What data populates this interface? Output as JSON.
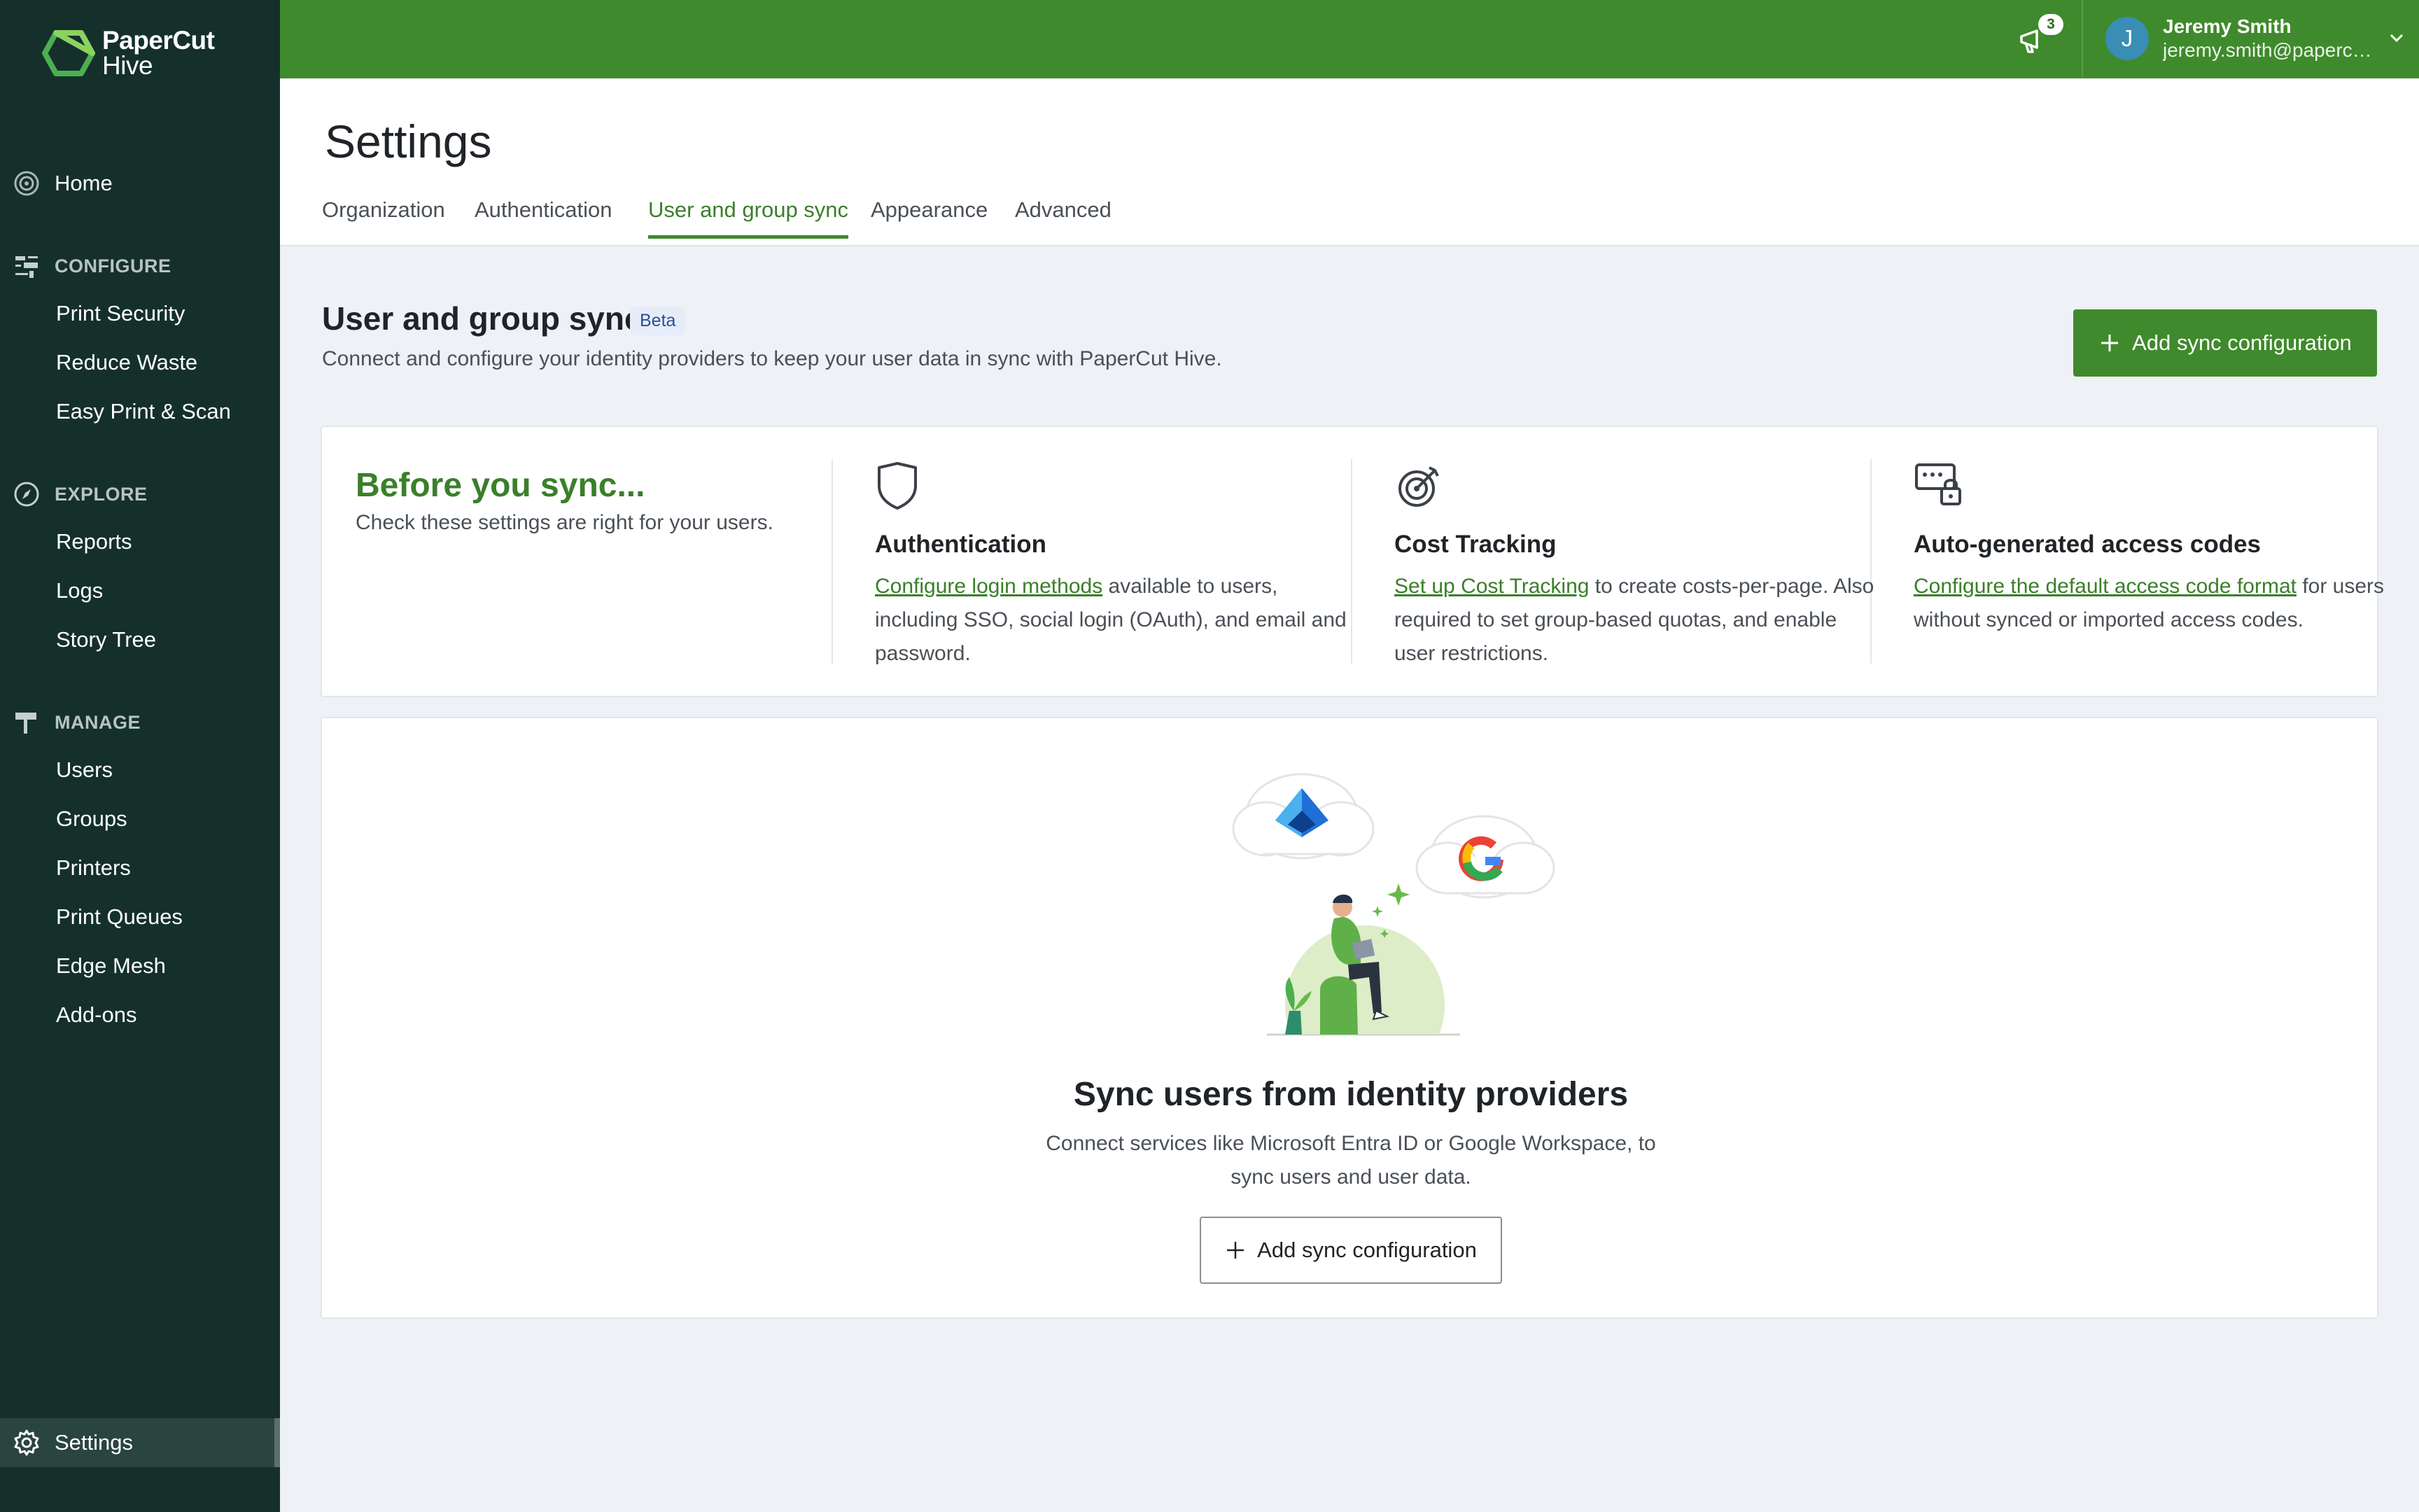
{
  "brand": {
    "line1": "PaperCut",
    "line2": "Hive",
    "color": "#3f8a2c"
  },
  "sidebar": {
    "home": "Home",
    "sections": [
      {
        "label": "CONFIGURE",
        "icon": "sliders-icon",
        "items": [
          "Print Security",
          "Reduce Waste",
          "Easy Print & Scan"
        ]
      },
      {
        "label": "EXPLORE",
        "icon": "compass-icon",
        "items": [
          "Reports",
          "Logs",
          "Story Tree"
        ]
      },
      {
        "label": "MANAGE",
        "icon": "signpost-icon",
        "items": [
          "Users",
          "Groups",
          "Printers",
          "Print Queues",
          "Edge Mesh",
          "Add-ons"
        ]
      }
    ],
    "settings": "Settings"
  },
  "topbar": {
    "notification_count": "3",
    "user": {
      "initial": "J",
      "name": "Jeremy Smith",
      "email": "jeremy.smith@papercut.com"
    }
  },
  "header": {
    "title": "Settings",
    "tabs": [
      "Organization",
      "Authentication",
      "User and group sync",
      "Appearance",
      "Advanced"
    ],
    "active_tab": "User and group sync"
  },
  "section": {
    "title": "User and group sync",
    "badge": "Beta",
    "subtitle": "Connect and configure your identity providers to keep your user data in sync with PaperCut Hive.",
    "add_button": "Add sync configuration"
  },
  "before_sync": {
    "title": "Before you sync...",
    "subtitle": "Check these settings are right for your users.",
    "columns": [
      {
        "icon": "shield-icon",
        "title": "Authentication",
        "link": "Configure login methods",
        "text": " available to users, including SSO, social login (OAuth), and email and password."
      },
      {
        "icon": "target-icon",
        "title": "Cost Tracking",
        "link": "Set up Cost Tracking",
        "text": " to create costs-per-page. Also required to set group-based quotas, and enable user restrictions."
      },
      {
        "icon": "access-code-lock-icon",
        "title": "Auto-generated access codes",
        "link": "Configure the default access code format",
        "text": " for users without synced or imported access codes."
      }
    ]
  },
  "empty_state": {
    "title": "Sync users from identity providers",
    "text": "Connect services like Microsoft Entra ID or Google Workspace, to sync users and user data.",
    "button": "Add sync configuration"
  }
}
